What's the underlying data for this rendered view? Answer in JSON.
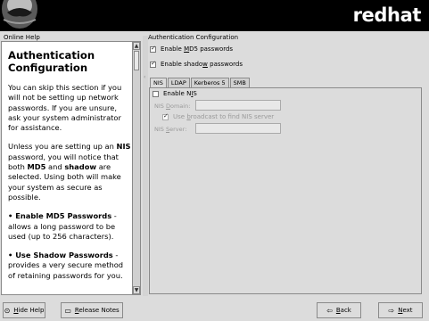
{
  "header": {
    "logo_icon": "shadowman-fedora-logo",
    "brand": "redhat"
  },
  "help": {
    "label": "Online Help",
    "title": "Authentication Configuration",
    "para1": "You can skip this section if you will not be setting up network passwords. If you are unsure, ask your system administrator for assistance.",
    "para2_a": "Unless you are setting up an ",
    "para2_nis": "NIS",
    "para2_b": " password, you will notice that both ",
    "para2_md5": "MD5",
    "para2_c": " and ",
    "para2_shadow": "shadow",
    "para2_d": " are selected. Using both will make your system as secure as possible.",
    "bullet1_title": "• Enable MD5 Passwords",
    "bullet1_text": " - allows a long password to be used (up to 256 characters).",
    "bullet2_title": "• Use Shadow Passwords",
    "bullet2_text": " - provides a very secure method of retaining passwords for you."
  },
  "auth": {
    "label": "Authentication Configuration",
    "md5": {
      "pre": "Enable ",
      "mn": "M",
      "post": "D5 passwords",
      "checked": true
    },
    "shadow": {
      "pre": "Enable shado",
      "mn": "w",
      "post": " passwords",
      "checked": true
    }
  },
  "tabs": [
    "NIS",
    "LDAP",
    "Kerberos 5",
    "SMB"
  ],
  "nis": {
    "enable": {
      "pre": "Enable N",
      "mn": "I",
      "post": "S",
      "checked": false
    },
    "domain_pre": "NIS ",
    "domain_mn": "D",
    "domain_post": "omain:",
    "domain_value": "",
    "broadcast": {
      "pre": "Use ",
      "mn": "b",
      "post": "roadcast to find NIS server",
      "checked": true
    },
    "server_pre": "NIS ",
    "server_mn": "S",
    "server_post": "erver:",
    "server_value": ""
  },
  "buttons": {
    "hide_help_icon": "help-icon",
    "hide_help": {
      "pre": "",
      "mn": "H",
      "post": "ide Help"
    },
    "release_notes_icon": "document-icon",
    "release_notes": {
      "pre": "",
      "mn": "R",
      "post": "elease Notes"
    },
    "back_icon": "arrow-left-icon",
    "back": {
      "pre": "",
      "mn": "B",
      "post": "ack"
    },
    "next_icon": "arrow-right-icon",
    "next": {
      "pre": "",
      "mn": "N",
      "post": "ext"
    }
  }
}
